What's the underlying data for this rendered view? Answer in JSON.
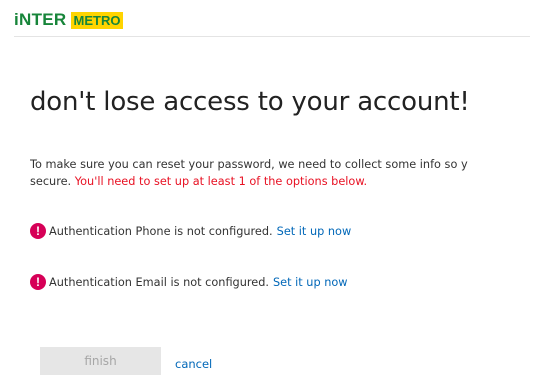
{
  "header": {
    "logo_part1": "iNTER",
    "logo_part2": "METRO"
  },
  "page": {
    "title": "don't lose access to your account!",
    "intro_line1": "To make sure you can reset your password, we need to collect some info so y",
    "intro_line2_plain": "secure.",
    "intro_line2_red": "You'll need to set up at least 1 of the options below."
  },
  "methods": [
    {
      "icon": "exclamation-alert-icon",
      "text": "Authentication Phone is not configured.",
      "link": "Set it up now"
    },
    {
      "icon": "exclamation-alert-icon",
      "text": "Authentication Email is not configured.",
      "link": "Set it up now"
    }
  ],
  "actions": {
    "finish_label": "finish",
    "cancel_label": "cancel"
  },
  "colors": {
    "accent_link": "#0067b8",
    "warning_red": "#e81123",
    "alert_icon": "#d60057",
    "logo_green": "#17853a",
    "logo_yellow": "#ffd400"
  }
}
